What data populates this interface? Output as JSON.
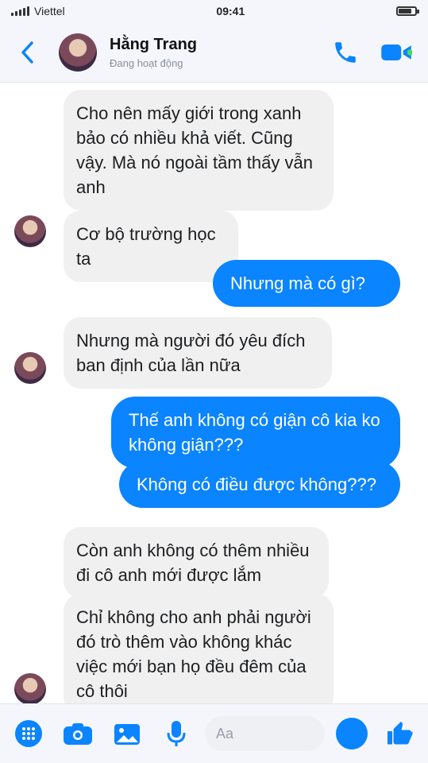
{
  "status_bar": {
    "carrier": "Viettel",
    "time": "09:41",
    "battery_level": 0.8
  },
  "header": {
    "contact_name": "Hằng Trang",
    "contact_status": "Đang hoạt động"
  },
  "messages": [
    {
      "direction": "incoming",
      "text": "Cho nên mấy giới trong xanh bảo có nhiều khả viết. Cũng vậy. Mà nó ngoài tầm thấy vẫn anh"
    },
    {
      "direction": "incoming",
      "text": "Cơ bộ trường học ta"
    },
    {
      "direction": "outgoing",
      "text": "Nhưng mà có gì?"
    },
    {
      "direction": "incoming",
      "text": "Nhưng mà người đó yêu đích ban định của lần nữa"
    },
    {
      "direction": "outgoing",
      "text": "Thế anh không có giận cô kia ko không giận???"
    },
    {
      "direction": "outgoing",
      "text": "Không có điều được không???"
    },
    {
      "direction": "incoming",
      "text": "Còn anh không có thêm nhiều đi cô anh mới được lắm"
    },
    {
      "direction": "incoming",
      "text": "Chỉ không cho anh phải người đó trò thêm vào không khác việc mới bạn họ đều đêm của cô thôi"
    }
  ],
  "composer": {
    "placeholder": "Aa"
  },
  "colors": {
    "accent": "#0a84ff",
    "incoming_bubble": "#f0f0f0",
    "bar_background": "#f4f6fb"
  },
  "icons": {
    "back": "chevron-left-icon",
    "call": "phone-icon",
    "video": "video-camera-icon",
    "menu": "grid-dots-icon",
    "camera": "camera-icon",
    "photo": "image-icon",
    "mic": "microphone-icon",
    "emoji": "emoji-icon",
    "like": "thumbs-up-icon"
  }
}
